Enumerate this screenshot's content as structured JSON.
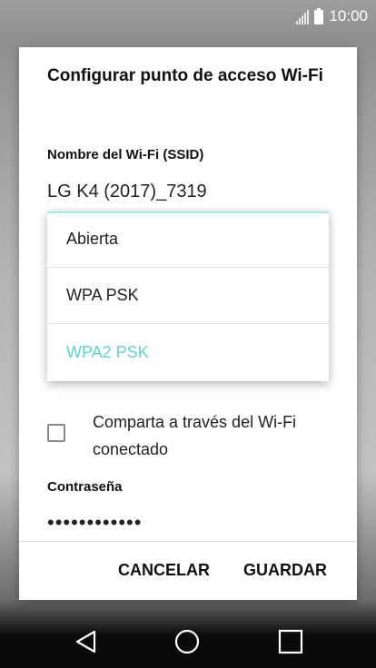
{
  "status_bar": {
    "time": "10:00",
    "icons": [
      "signal-icon",
      "battery-icon"
    ]
  },
  "dialog": {
    "title": "Configurar punto de acceso Wi-Fi",
    "ssid_label": "Nombre del Wi-Fi (SSID)",
    "ssid_value": "LG K4 (2017)_7319",
    "security_dropdown": {
      "options": [
        "Abierta",
        "WPA PSK",
        "WPA2 PSK"
      ],
      "selected": "WPA2 PSK",
      "selected_color": "#5fd6c8"
    },
    "share_checkbox": {
      "label": "Comparta a través del Wi-Fi conectado",
      "checked": false
    },
    "password_label": "Contraseña",
    "password_value": "••••••••••••",
    "buttons": {
      "cancel": "CANCELAR",
      "save": "GUARDAR"
    }
  },
  "nav_bar": {
    "icons": [
      "back-icon",
      "home-icon",
      "recent-apps-icon"
    ]
  }
}
